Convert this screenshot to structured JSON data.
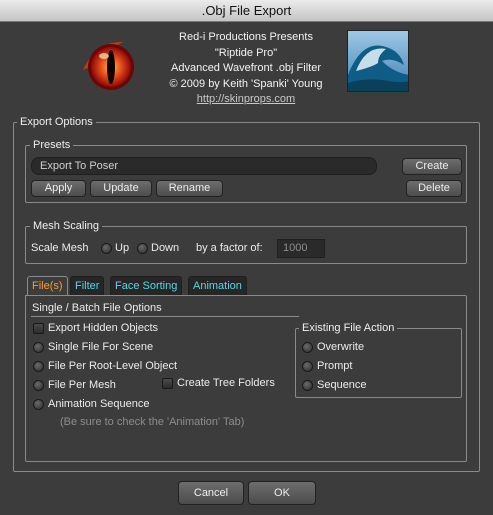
{
  "window": {
    "title": ".Obj File Export"
  },
  "header": {
    "lines": [
      "Red-i Productions Presents",
      "\"Riptide Pro\"",
      "Advanced Wavefront .obj Filter",
      "© 2009 by Keith 'Spanki' Young"
    ],
    "link": "http://skinprops.com",
    "logo_icon": "red-eye-logo-icon",
    "thumb_icon": "wave-thumbnail-icon"
  },
  "export_options": {
    "title": "Export Options",
    "presets": {
      "title": "Presets",
      "current": "Export To Poser",
      "buttons": {
        "apply": "Apply",
        "update": "Update",
        "rename": "Rename",
        "create": "Create",
        "delete": "Delete"
      }
    },
    "mesh_scaling": {
      "title": "Mesh Scaling",
      "label": "Scale Mesh",
      "up": "Up",
      "down": "Down",
      "factor_label": "by a factor of:",
      "factor_placeholder": "1000"
    },
    "tabs": [
      "File(s)",
      "Filter",
      "Face Sorting",
      "Animation"
    ],
    "active_tab": "File(s)",
    "files": {
      "title": "Single / Batch  File Options",
      "export_hidden": "Export Hidden Objects",
      "single_file": "Single File For Scene",
      "file_per_root": "File Per Root-Level Object",
      "file_per_mesh": "File Per Mesh",
      "create_tree_folders": "Create Tree Folders",
      "animation_sequence": "Animation Sequence",
      "hint": "(Be sure to check the 'Animation' Tab)"
    },
    "existing_file": {
      "title": "Existing File Action",
      "overwrite": "Overwrite",
      "prompt": "Prompt",
      "sequence": "Sequence"
    }
  },
  "footer": {
    "cancel": "Cancel",
    "ok": "OK"
  },
  "colors": {
    "background": "#3c3c3c",
    "tab_text": "#56d7e6",
    "active_tab_text": "#ff9a35"
  }
}
